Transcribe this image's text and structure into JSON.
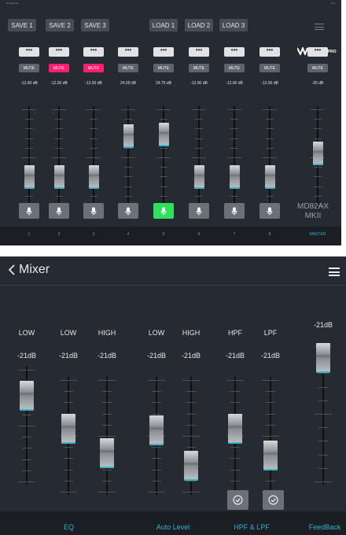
{
  "top": {
    "preset_buttons": [
      "SAVE 1",
      "SAVE 2",
      "SAVE 3",
      "LOAD 1",
      "LOAD 2",
      "LOAD 3"
    ],
    "logo_text": "WORKPRO",
    "mute_label": "MUTE",
    "channels": [
      {
        "num": "1",
        "db": "-12.00 dB",
        "muted": false,
        "level": 0.25,
        "mic_on": false
      },
      {
        "num": "2",
        "db": "-12.00 dB",
        "muted": true,
        "level": 0.25,
        "mic_on": false
      },
      {
        "num": "3",
        "db": "-12.00 dB",
        "muted": true,
        "level": 0.25,
        "mic_on": false
      },
      {
        "num": "4",
        "db": "24.00 dB",
        "muted": false,
        "level": 0.77,
        "mic_on": false
      },
      {
        "num": "5",
        "db": "24.75 dB",
        "muted": false,
        "level": 0.79,
        "mic_on": true
      },
      {
        "num": "6",
        "db": "-12.00 dB",
        "muted": false,
        "level": 0.25,
        "mic_on": false
      },
      {
        "num": "7",
        "db": "-12.00 dB",
        "muted": false,
        "level": 0.25,
        "mic_on": false
      },
      {
        "num": "8",
        "db": "-12.00 dB",
        "muted": false,
        "level": 0.25,
        "mic_on": false
      }
    ],
    "master": {
      "label": "MASTER",
      "db": "-26 dB",
      "level": 0.55
    },
    "model": [
      "MD82AX",
      "MKII"
    ]
  },
  "bottom": {
    "title": "Mixer",
    "faders": [
      {
        "label": "LOW",
        "db": "-21dB",
        "level": 0.84
      },
      {
        "label": "LOW",
        "db": "-21dB",
        "level": 0.58
      },
      {
        "label": "HIGH",
        "db": "-21dB",
        "level": 0.3
      },
      {
        "label": "LOW",
        "db": "-21dB",
        "level": 0.56
      },
      {
        "label": "HIGH",
        "db": "-21dB",
        "level": 0.16
      },
      {
        "label": "HPF",
        "db": "-21dB",
        "level": 0.58
      },
      {
        "label": "LPF",
        "db": "-21dB",
        "level": 0.28
      },
      {
        "label": "",
        "db": "-21dB",
        "level": 1.0
      }
    ],
    "sections": [
      "EQ",
      "Auto Level",
      "HPF & LPF",
      "FeedBack"
    ]
  },
  "colors": {
    "accent": "#37b0d0",
    "mute_on": "#ff1f6e",
    "mic_on": "#31e05a",
    "panel": "#262a31"
  },
  "icons": {
    "mic": "mic-icon",
    "menu": "menu-icon",
    "back": "chevron-left-icon",
    "check": "check-icon"
  }
}
